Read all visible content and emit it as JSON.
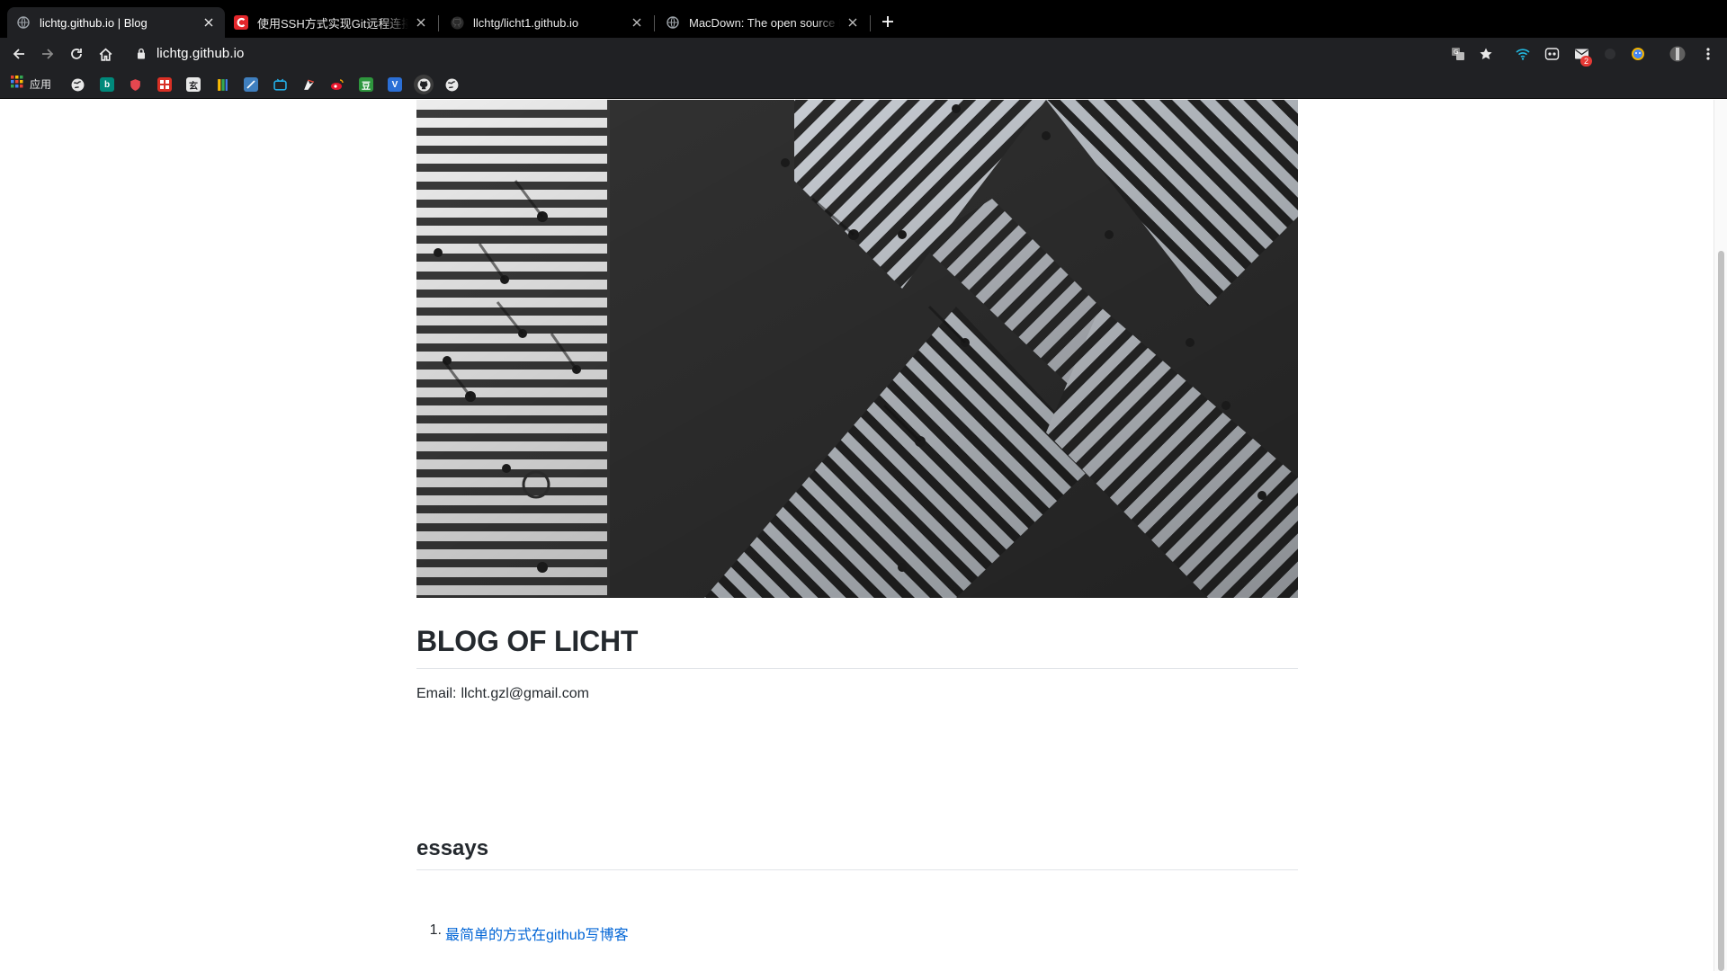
{
  "browser": {
    "tabs": [
      {
        "title": "lichtg.github.io | Blog",
        "active": true,
        "icon": "globe-icon"
      },
      {
        "title": "使用SSH方式实现Git远程连接GitHub",
        "active": false,
        "icon": "csdn-icon"
      },
      {
        "title": "llchtg/licht1.github.io",
        "active": false,
        "icon": "github-icon"
      },
      {
        "title": "MacDown: The open source Markdown editor",
        "active": false,
        "icon": "globe-icon"
      }
    ],
    "new_tab_icon": "plus-icon",
    "address_bar": {
      "url": "lichtg.github.io",
      "secure_icon": "lock-icon"
    },
    "toolbar_icons": [
      "back-icon",
      "forward-icon",
      "reload-icon",
      "home-icon",
      "translate-icon",
      "bookmark-star-icon",
      "wifi-icon",
      "ext-robot-icon",
      "mail-icon",
      "ext-icon",
      "ext-avatar-icon",
      "profile-icon",
      "menu-icon"
    ],
    "mail_badge": "2",
    "bookmarks": {
      "apps_label": "应用",
      "items": [
        "globe-icon",
        "bing-icon",
        "shield-icon",
        "grid-icon",
        "ext-icon",
        "ext-icon",
        "check-icon",
        "bilibili-icon",
        "ext-icon",
        "weibo-icon",
        "douban-icon",
        "v-icon",
        "github-icon",
        "globe-icon"
      ]
    },
    "colors": {
      "tab_bar": "#000000",
      "toolbar": "#202124",
      "link": "#0366d6",
      "text": "#24292e"
    }
  },
  "page": {
    "hero_image": "aerial-crosswalk-photo",
    "title": "BLOG OF LICHT",
    "email_label": "Email:",
    "email_value": "llcht.gzl@gmail.com",
    "section_title": "essays",
    "essays": [
      {
        "number": "1.",
        "title": "最简单的方式在github写博客"
      }
    ]
  }
}
